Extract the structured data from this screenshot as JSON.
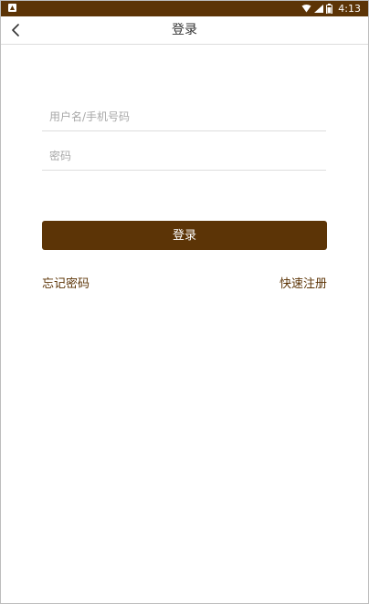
{
  "status_bar": {
    "time": "4:13",
    "icons": [
      "notification-icon",
      "wifi-icon",
      "signal-icon",
      "battery-icon"
    ],
    "background": "#5c3406"
  },
  "app_bar": {
    "title": "登录",
    "back_icon": "chevron-left-icon"
  },
  "form": {
    "username_placeholder": "用户名/手机号码",
    "username_value": "",
    "password_placeholder": "密码",
    "password_value": "",
    "login_button_label": "登录",
    "forgot_password_label": "忘记密码",
    "register_label": "快速注册"
  },
  "colors": {
    "brand": "#5c3406",
    "link": "#5c3406",
    "placeholder": "#a8a8a8"
  }
}
